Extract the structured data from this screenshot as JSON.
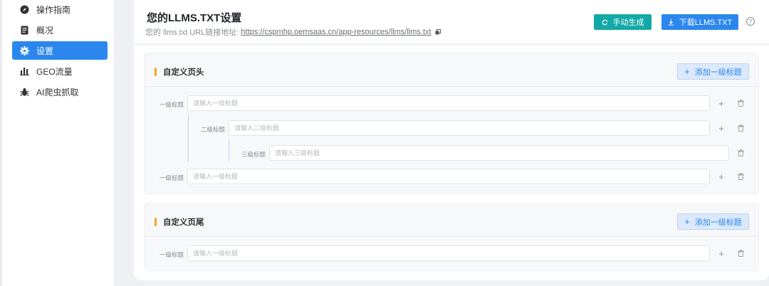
{
  "sidebar": {
    "items": [
      {
        "label": "操作指南",
        "icon": "compass-icon"
      },
      {
        "label": "概况",
        "icon": "document-icon"
      },
      {
        "label": "设置",
        "icon": "gear-icon",
        "active": true
      },
      {
        "label": "GEO流量",
        "icon": "bar-chart-icon"
      },
      {
        "label": "AI爬虫抓取",
        "icon": "bug-icon"
      }
    ]
  },
  "header": {
    "title": "您的LLMS.TXT设置",
    "url_prefix": "您的 llms.txt URL链接地址:",
    "url": "https://cspmhp.oemsaas.cn/app-resources/llms/llms.txt",
    "generate_label": "手动生成",
    "download_label": "下载LLMS.TXT",
    "help_symbol": "?"
  },
  "header_section": {
    "title": "自定义页头",
    "add_label": "添加一级标题",
    "rows": [
      {
        "level_label": "一级标题",
        "placeholder": "请输入一级标题"
      },
      {
        "level_label": "二级标题",
        "placeholder": "请输入二级标题"
      },
      {
        "level_label": "三级标题",
        "placeholder": "请输入三级标题"
      },
      {
        "level_label": "一级标题",
        "placeholder": "请输入一级标题"
      }
    ]
  },
  "footer_section": {
    "title": "自定义页尾",
    "add_label": "添加一级标题",
    "rows": [
      {
        "level_label": "一级标题",
        "placeholder": "请输入一级标题"
      }
    ]
  },
  "colors": {
    "primary": "#2b87ee",
    "teal": "#13a9a6",
    "accent_bar": "#f5a524"
  }
}
